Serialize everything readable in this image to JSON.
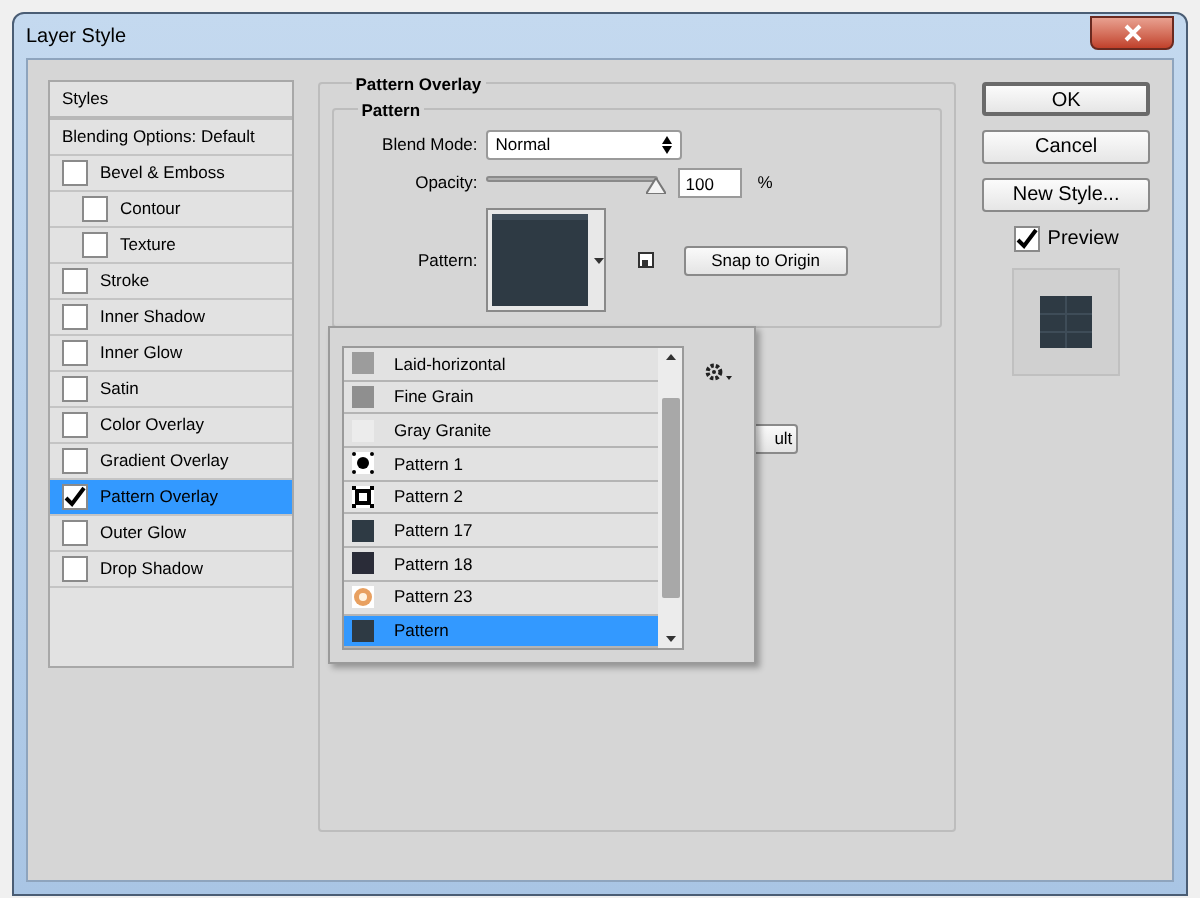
{
  "window": {
    "title": "Layer Style"
  },
  "styles_panel": {
    "header": "Styles",
    "blending": "Blending Options: Default",
    "items": [
      {
        "label": "Bevel & Emboss",
        "checked": false,
        "selected": false,
        "children": [
          {
            "label": "Contour",
            "checked": false,
            "selected": false
          },
          {
            "label": "Texture",
            "checked": false,
            "selected": false
          }
        ]
      },
      {
        "label": "Stroke",
        "checked": false,
        "selected": false
      },
      {
        "label": "Inner Shadow",
        "checked": false,
        "selected": false
      },
      {
        "label": "Inner Glow",
        "checked": false,
        "selected": false
      },
      {
        "label": "Satin",
        "checked": false,
        "selected": false
      },
      {
        "label": "Color Overlay",
        "checked": false,
        "selected": false
      },
      {
        "label": "Gradient Overlay",
        "checked": false,
        "selected": false
      },
      {
        "label": "Pattern Overlay",
        "checked": true,
        "selected": true
      },
      {
        "label": "Outer Glow",
        "checked": false,
        "selected": false
      },
      {
        "label": "Drop Shadow",
        "checked": false,
        "selected": false
      }
    ]
  },
  "pattern_overlay": {
    "title": "Pattern Overlay",
    "group": "Pattern",
    "blend_mode_label": "Blend Mode:",
    "blend_mode": "Normal",
    "opacity_label": "Opacity:",
    "opacity": {
      "level": 1.0
    },
    "opacity_value": "100",
    "opacity_unit": "%",
    "pattern_label": "Pattern:",
    "snap_button": "Snap to Origin",
    "hidden_button": "ult"
  },
  "pattern_picker": {
    "items": [
      {
        "name": "Laid-horizontal",
        "kind": "solid",
        "color": "#9c9c9c",
        "selected": false
      },
      {
        "name": "Fine Grain",
        "kind": "solid",
        "color": "#8f8f8f",
        "selected": false
      },
      {
        "name": "Gray Granite",
        "kind": "solid",
        "color": "#ececec",
        "selected": false
      },
      {
        "name": "Pattern 1",
        "kind": "dots",
        "color": "#000000",
        "selected": false
      },
      {
        "name": "Pattern 2",
        "kind": "frame",
        "color": "#000000",
        "selected": false
      },
      {
        "name": "Pattern 17",
        "kind": "solid",
        "color": "#2e3a44",
        "selected": false
      },
      {
        "name": "Pattern 18",
        "kind": "solid",
        "color": "#2a2c38",
        "selected": false
      },
      {
        "name": "Pattern 23",
        "kind": "flower",
        "color": "#e8a060",
        "selected": false
      },
      {
        "name": "Pattern",
        "kind": "solid",
        "color": "#2e3a44",
        "selected": true
      }
    ]
  },
  "buttons": [
    {
      "label": "OK",
      "default": true
    },
    {
      "label": "Cancel",
      "default": false
    },
    {
      "label": "New Style...",
      "default": false
    }
  ],
  "preview": {
    "label": "Preview",
    "checked": true
  }
}
